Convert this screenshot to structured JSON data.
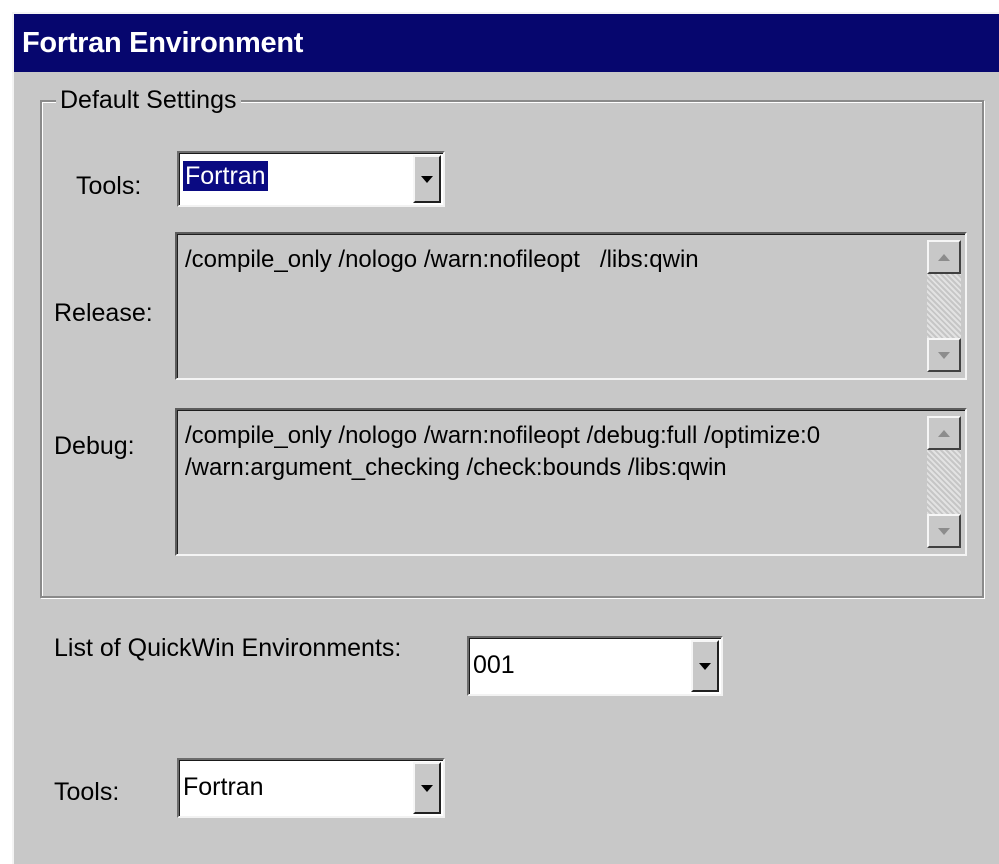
{
  "window": {
    "title": "Fortran Environment"
  },
  "default_settings": {
    "title": "Default Settings",
    "tools_label": "Tools:",
    "tools_value": "Fortran",
    "release_label": "Release:",
    "release_options": "/compile_only /nologo /warn:nofileopt   /libs:qwin",
    "debug_label": "Debug:",
    "debug_options": "/compile_only /nologo /warn:nofileopt /debug:full /optimize:0\n/warn:argument_checking /check:bounds /libs:qwin"
  },
  "environments": {
    "list_label": "List of QuickWin Environments:",
    "selected": "001",
    "tools_label": "Tools:",
    "tools_value": "Fortran"
  },
  "icons": {
    "dropdown": "chevron-down-icon",
    "scroll_up": "scroll-up-icon",
    "scroll_down": "scroll-down-icon"
  },
  "colors": {
    "titlebar": "#06066e",
    "dialog_bg": "#c8c8c8",
    "selection": "#0a0a82"
  }
}
